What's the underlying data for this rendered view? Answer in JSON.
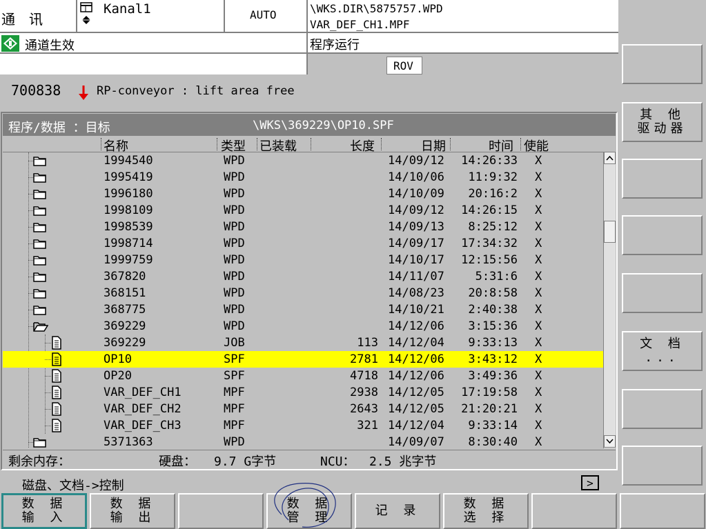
{
  "header": {
    "comm": "通 讯",
    "channel": "Kanal1",
    "mode": "AUTO",
    "path_line1": "\\WKS.DIR\\5875757.WPD",
    "path_line2": "VAR_DEF_CH1.MPF",
    "channel_status": "通道生效",
    "program_status": "程序运行",
    "rov": "ROV"
  },
  "alarm": {
    "number": "700838",
    "text": "RP-conveyor : lift area free"
  },
  "panel": {
    "title_left": "程序/数据 ：目标",
    "title_path": "\\WKS\\369229\\OP10.SPF",
    "columns": [
      "名称",
      "类型",
      "已装载",
      "长度",
      "日期",
      "时间",
      "使能"
    ],
    "rows": [
      {
        "icon": "folder",
        "name": "1994540",
        "type": "WPD",
        "length": "",
        "date": "14/09/12",
        "time": "14:26:33",
        "enable": "X"
      },
      {
        "icon": "folder",
        "name": "1995419",
        "type": "WPD",
        "length": "",
        "date": "14/10/06",
        "time": "11:9:32",
        "enable": "X"
      },
      {
        "icon": "folder",
        "name": "1996180",
        "type": "WPD",
        "length": "",
        "date": "14/10/09",
        "time": "20:16:2",
        "enable": "X"
      },
      {
        "icon": "folder",
        "name": "1998109",
        "type": "WPD",
        "length": "",
        "date": "14/09/12",
        "time": "14:26:15",
        "enable": "X"
      },
      {
        "icon": "folder",
        "name": "1998539",
        "type": "WPD",
        "length": "",
        "date": "14/09/13",
        "time": "8:25:12",
        "enable": "X"
      },
      {
        "icon": "folder",
        "name": "1998714",
        "type": "WPD",
        "length": "",
        "date": "14/09/17",
        "time": "17:34:32",
        "enable": "X"
      },
      {
        "icon": "folder",
        "name": "1999759",
        "type": "WPD",
        "length": "",
        "date": "14/10/17",
        "time": "12:15:56",
        "enable": "X"
      },
      {
        "icon": "folder",
        "name": "367820",
        "type": "WPD",
        "length": "",
        "date": "14/11/07",
        "time": "5:31:6",
        "enable": "X"
      },
      {
        "icon": "folder",
        "name": "368151",
        "type": "WPD",
        "length": "",
        "date": "14/08/23",
        "time": "20:8:58",
        "enable": "X"
      },
      {
        "icon": "folder",
        "name": "368775",
        "type": "WPD",
        "length": "",
        "date": "14/10/21",
        "time": "2:40:38",
        "enable": "X"
      },
      {
        "icon": "folder-open",
        "name": "369229",
        "type": "WPD",
        "length": "",
        "date": "14/12/06",
        "time": "3:15:36",
        "enable": "X"
      },
      {
        "icon": "file",
        "name": "369229",
        "type": "JOB",
        "length": "113",
        "date": "14/12/04",
        "time": "9:33:13",
        "enable": "X"
      },
      {
        "icon": "file-selected",
        "name": "OP10",
        "type": "SPF",
        "length": "2781",
        "date": "14/12/06",
        "time": "3:43:12",
        "enable": "X"
      },
      {
        "icon": "file",
        "name": "OP20",
        "type": "SPF",
        "length": "4718",
        "date": "14/12/06",
        "time": "3:49:36",
        "enable": "X"
      },
      {
        "icon": "file",
        "name": "VAR_DEF_CH1",
        "type": "MPF",
        "length": "2938",
        "date": "14/12/05",
        "time": "17:19:58",
        "enable": "X"
      },
      {
        "icon": "file",
        "name": "VAR_DEF_CH2",
        "type": "MPF",
        "length": "2643",
        "date": "14/12/05",
        "time": "21:20:21",
        "enable": "X"
      },
      {
        "icon": "file",
        "name": "VAR_DEF_CH3",
        "type": "MPF",
        "length": "321",
        "date": "14/12/04",
        "time": "9:33:14",
        "enable": "X"
      },
      {
        "icon": "folder",
        "name": "5371363",
        "type": "WPD",
        "length": "",
        "date": "14/09/07",
        "time": "8:30:40",
        "enable": "X"
      }
    ],
    "selected_index": 12,
    "memory_label": "剩余内存：",
    "disk_label": "硬盘：",
    "disk_value": "9.7 G字节",
    "ncu_label": "NCU：",
    "ncu_value": "2.5 兆字节"
  },
  "status_line": "磁盘、文档->控制",
  "expand_symbol": ">",
  "softkeys_right": [
    "",
    "其 他\n驱动器",
    "",
    "",
    "",
    "文 档\n...",
    "",
    ""
  ],
  "softkeys_bottom": [
    "数 据\n输 入",
    "数 据\n输 出",
    "",
    "数 据\n管 理",
    "记 录",
    "数 据\n选 择",
    "",
    ""
  ],
  "colors": {
    "selection": "#ffff00",
    "background": "#c0c0c0",
    "title_bar": "#808080",
    "alarm_arrow": "#e00000",
    "status_icon": "#1a9a3a"
  }
}
